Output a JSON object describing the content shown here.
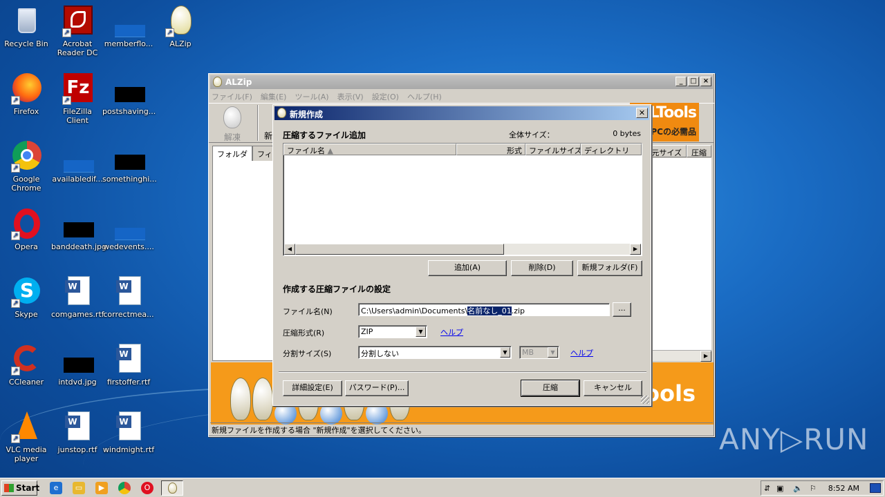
{
  "desktop": {
    "icons": [
      {
        "label": "Recycle Bin",
        "icon": "recycle-bin-icon"
      },
      {
        "label": "Acrobat Reader DC",
        "icon": "acrobat-icon"
      },
      {
        "label": "memberflo...",
        "icon": "file-icon"
      },
      {
        "label": "ALZip",
        "icon": "alzip-icon"
      },
      {
        "label": "Firefox",
        "icon": "firefox-icon"
      },
      {
        "label": "FileZilla Client",
        "icon": "filezilla-icon"
      },
      {
        "label": "postshaving...",
        "icon": "file-icon"
      },
      {
        "label": "Google Chrome",
        "icon": "chrome-icon"
      },
      {
        "label": "availabledif...",
        "icon": "file-icon"
      },
      {
        "label": "somethinghi...",
        "icon": "file-icon"
      },
      {
        "label": "Opera",
        "icon": "opera-icon"
      },
      {
        "label": "banddeath.jpg",
        "icon": "image-file-icon"
      },
      {
        "label": "wedevents....",
        "icon": "file-icon"
      },
      {
        "label": "Skype",
        "icon": "skype-icon"
      },
      {
        "label": "comgames.rtf",
        "icon": "word-doc-icon"
      },
      {
        "label": "correctmea...",
        "icon": "word-doc-icon"
      },
      {
        "label": "CCleaner",
        "icon": "ccleaner-icon"
      },
      {
        "label": "intdvd.jpg",
        "icon": "image-file-icon"
      },
      {
        "label": "firstoffer.rtf",
        "icon": "word-doc-icon"
      },
      {
        "label": "VLC media player",
        "icon": "vlc-icon"
      },
      {
        "label": "junstop.rtf",
        "icon": "word-doc-icon"
      },
      {
        "label": "windmight.rtf",
        "icon": "word-doc-icon"
      }
    ]
  },
  "alzip": {
    "title": "ALZip",
    "menu": [
      "ファイル(F)",
      "編集(E)",
      "ツール(A)",
      "表示(V)",
      "設定(O)",
      "ヘルプ(H)"
    ],
    "toolbar": {
      "decompress": "解凍",
      "new_partial": "新"
    },
    "banner_top": {
      "line1": "LTools",
      "line2": "OPCの必需品"
    },
    "tabs": [
      "フォルダ",
      "フィルタ"
    ],
    "right_cols": [
      "元サイズ",
      "圧縮"
    ],
    "banner_bottom": "ools",
    "status": "新規ファイルを作成する場合 \"新規作成\"を選択してください。"
  },
  "dialog": {
    "title": "新規作成",
    "section_add": "圧縮するファイル追加",
    "total_size_label": "全体サイズ：",
    "total_size_value": "0 bytes",
    "columns": [
      "ファイル名",
      "形式",
      "ファイルサイズ",
      "ディレクトリ"
    ],
    "btn_add": "追加(A)",
    "btn_delete": "削除(D)",
    "btn_new_folder": "新規フォルダ(F)",
    "section_settings": "作成する圧縮ファイルの設定",
    "filename_label": "ファイル名(N)",
    "filename_prefix": "C:\\Users\\admin\\Documents\\",
    "filename_selected": "名前なし_01",
    "filename_suffix": ".zip",
    "browse": "...",
    "format_label": "圧縮形式(R)",
    "format_value": "ZIP",
    "help": "ヘルプ",
    "split_label": "分割サイズ(S)",
    "split_value": "分割しない",
    "unit_value": "MB",
    "btn_advanced": "詳細設定(E)",
    "btn_password": "パスワード(P)...",
    "btn_compress": "圧縮",
    "btn_cancel": "キャンセル"
  },
  "taskbar": {
    "start": "Start",
    "clock": "8:52 AM"
  },
  "watermark": "ANY▷RUN"
}
